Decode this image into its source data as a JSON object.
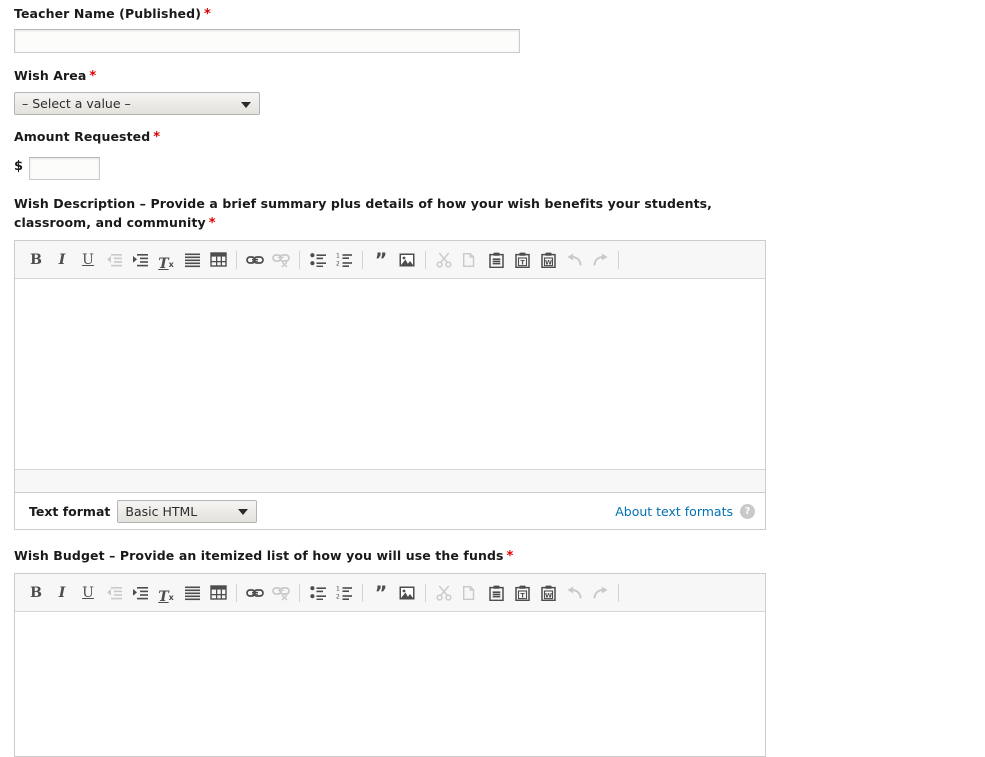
{
  "form": {
    "teacher_name": {
      "label": "Teacher Name (Published)",
      "required_marker": "*",
      "value": "",
      "placeholder": ""
    },
    "wish_area": {
      "label": "Wish Area",
      "required_marker": "*",
      "selected": "– Select a value –",
      "options": [
        "– Select a value –"
      ]
    },
    "amount_requested": {
      "label": "Amount Requested",
      "required_marker": "*",
      "currency_symbol": "$",
      "value": "",
      "placeholder": ""
    },
    "wish_description": {
      "label": "Wish Description – Provide a brief summary plus details of how your wish benefits your students, classroom, and community",
      "required_marker": "*",
      "body_text": ""
    },
    "wish_budget": {
      "label": "Wish Budget – Provide an itemized list of how you will use the funds",
      "required_marker": "*",
      "body_text": ""
    }
  },
  "text_format": {
    "label": "Text format",
    "selected": "Basic HTML",
    "options": [
      "Basic HTML"
    ],
    "about_link": "About text formats",
    "help_glyph": "?"
  },
  "toolbar": {
    "items": [
      {
        "name": "bold-icon",
        "glyph": "B",
        "disabled": false,
        "type": "text"
      },
      {
        "name": "italic-icon",
        "glyph": "I",
        "disabled": false,
        "type": "text"
      },
      {
        "name": "underline-icon",
        "glyph": "U",
        "disabled": false,
        "type": "text"
      },
      {
        "name": "outdent-icon",
        "glyph": "",
        "disabled": true,
        "type": "outdent"
      },
      {
        "name": "indent-icon",
        "glyph": "",
        "disabled": false,
        "type": "indent"
      },
      {
        "name": "remove-format-icon",
        "glyph": "",
        "disabled": false,
        "type": "removeformat"
      },
      {
        "name": "align-justify-icon",
        "glyph": "",
        "disabled": false,
        "type": "justify"
      },
      {
        "name": "table-icon",
        "glyph": "",
        "disabled": false,
        "type": "table"
      },
      {
        "name": "toolbar-separator",
        "glyph": "",
        "disabled": false,
        "type": "sep"
      },
      {
        "name": "link-icon",
        "glyph": "",
        "disabled": false,
        "type": "link"
      },
      {
        "name": "unlink-icon",
        "glyph": "",
        "disabled": true,
        "type": "unlink"
      },
      {
        "name": "toolbar-separator",
        "glyph": "",
        "disabled": false,
        "type": "sep"
      },
      {
        "name": "bulleted-list-icon",
        "glyph": "",
        "disabled": false,
        "type": "ul"
      },
      {
        "name": "numbered-list-icon",
        "glyph": "",
        "disabled": false,
        "type": "ol"
      },
      {
        "name": "toolbar-separator",
        "glyph": "",
        "disabled": false,
        "type": "sep"
      },
      {
        "name": "blockquote-icon",
        "glyph": "",
        "disabled": false,
        "type": "quote"
      },
      {
        "name": "image-icon",
        "glyph": "",
        "disabled": false,
        "type": "image"
      },
      {
        "name": "toolbar-separator",
        "glyph": "",
        "disabled": false,
        "type": "sep"
      },
      {
        "name": "cut-icon",
        "glyph": "",
        "disabled": true,
        "type": "cut"
      },
      {
        "name": "copy-icon",
        "glyph": "",
        "disabled": true,
        "type": "copy"
      },
      {
        "name": "paste-icon",
        "glyph": "",
        "disabled": false,
        "type": "paste"
      },
      {
        "name": "paste-as-text-icon",
        "glyph": "T",
        "disabled": false,
        "type": "pasteletter"
      },
      {
        "name": "paste-from-word-icon",
        "glyph": "W",
        "disabled": false,
        "type": "pasteletter"
      },
      {
        "name": "undo-icon",
        "glyph": "",
        "disabled": true,
        "type": "undo"
      },
      {
        "name": "redo-icon",
        "glyph": "",
        "disabled": true,
        "type": "redo"
      },
      {
        "name": "toolbar-separator",
        "glyph": "",
        "disabled": false,
        "type": "sep"
      }
    ]
  },
  "colors": {
    "required_red": "#e00000",
    "link_blue": "#0071b3",
    "label_text": "#1a1a1a",
    "toolbar_bg": "#f7f7f7",
    "border": "#cccccc"
  }
}
